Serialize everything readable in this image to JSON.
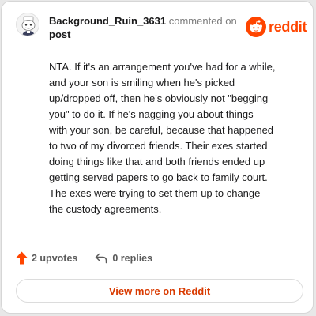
{
  "comment": {
    "username": "Background_Ruin_3631",
    "action_text": "commented on",
    "target_text": "post",
    "body": "NTA. If it's an arrangement you've had for a while,\nand your son is smiling when he's picked\nup/dropped off, then he's obviously not \"begging\nyou\" to do it. If he's nagging you about things\nwith your son, be careful, because that happened\nto two of my divorced friends. Their exes started\ndoing things like that and both friends ended up\ngetting served papers to go back to family court.\nThe exes were trying to set them up to change\nthe custody agreements.",
    "upvotes_label": "2 upvotes",
    "replies_label": "0 replies"
  },
  "brand": {
    "wordmark": "reddit",
    "color": "#ff4500"
  },
  "footer": {
    "view_more_label": "View more on Reddit"
  },
  "icons": {
    "avatar": "snoo-avatar",
    "logo": "reddit-snoo-icon",
    "upvote": "upvote-arrow-icon",
    "reply": "reply-arrow-icon"
  }
}
